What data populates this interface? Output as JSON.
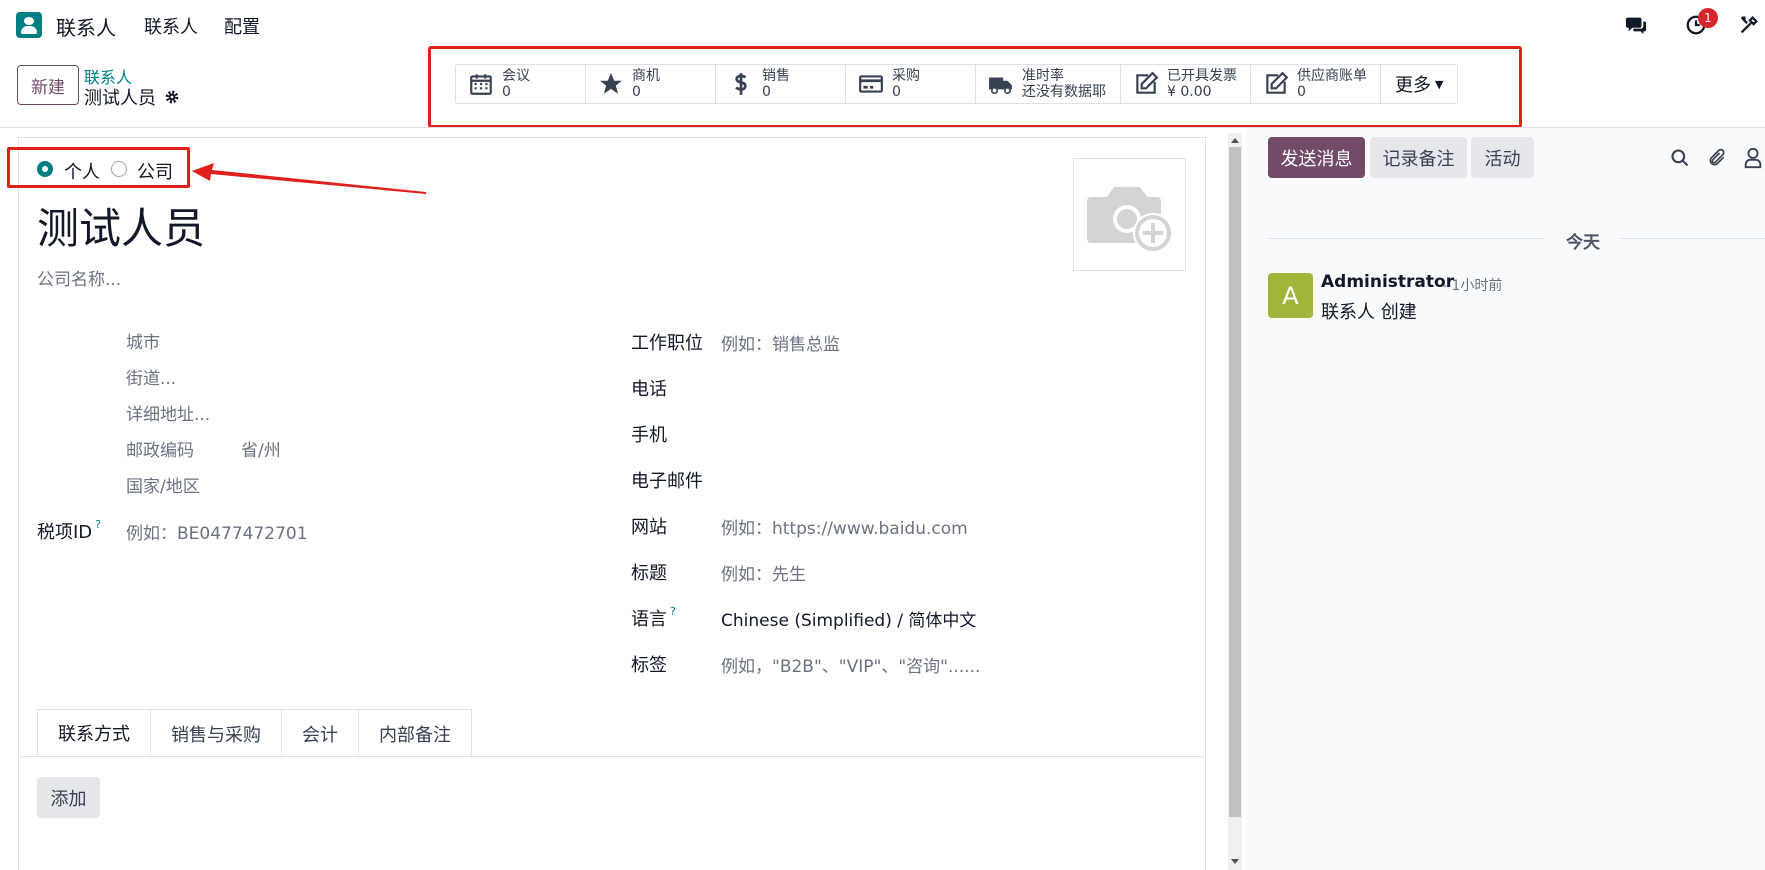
{
  "topbar": {
    "app_name": "联系人",
    "menu": [
      "联系人",
      "配置"
    ],
    "activity_badge": "1"
  },
  "control": {
    "new_label": "新建",
    "breadcrumb_parent": "联系人",
    "breadcrumb_current": "测试人员"
  },
  "stats": [
    {
      "label": "会议",
      "value": "0",
      "icon": "calendar-icon"
    },
    {
      "label": "商机",
      "value": "0",
      "icon": "star-icon"
    },
    {
      "label": "销售",
      "value": "0",
      "icon": "dollar-icon"
    },
    {
      "label": "采购",
      "value": "0",
      "icon": "credit-card-icon"
    },
    {
      "label": "准时率",
      "value": "还没有数据耶",
      "icon": "truck-icon"
    },
    {
      "label": "已开具发票",
      "value": "¥ 0.00",
      "icon": "edit-icon"
    },
    {
      "label": "供应商账单",
      "value": "0",
      "icon": "edit-icon"
    }
  ],
  "stats_more": "更多",
  "form": {
    "type_person": "个人",
    "type_company": "公司",
    "name": "测试人员",
    "company_placeholder": "公司名称...",
    "address": {
      "city": "城市",
      "street": "街道...",
      "street2": "详细地址...",
      "zip": "邮政编码",
      "state": "省/州",
      "country": "国家/地区"
    },
    "vat_label": "税项ID",
    "vat_help": "?",
    "vat_placeholder": "例如：BE0477472701",
    "right_fields": [
      {
        "label": "工作职位",
        "value": "例如：销售总监"
      },
      {
        "label": "电话",
        "value": ""
      },
      {
        "label": "手机",
        "value": ""
      },
      {
        "label": "电子邮件",
        "value": ""
      },
      {
        "label": "网站",
        "value": "例如：https://www.baidu.com"
      },
      {
        "label": "标题",
        "value": "例如：先生"
      },
      {
        "label": "语言",
        "value": "Chinese (Simplified) / 简体中文",
        "help": "?"
      },
      {
        "label": "标签",
        "value": "例如，\"B2B\"、\"VIP\"、\"咨询\"......"
      }
    ],
    "tabs": [
      "联系方式",
      "销售与采购",
      "会计",
      "内部备注"
    ],
    "add_label": "添加"
  },
  "chatter": {
    "send_label": "发送消息",
    "log_label": "记录备注",
    "activity_label": "活动",
    "today_label": "今天",
    "message": {
      "avatar_letter": "A",
      "author": "Administrator",
      "time": "- 1小时前",
      "body": "联系人 创建"
    }
  },
  "colors": {
    "brand": "#714b67",
    "teal": "#017e84",
    "highlight": "#e0201b",
    "avatar_bg": "#a2b53a"
  }
}
